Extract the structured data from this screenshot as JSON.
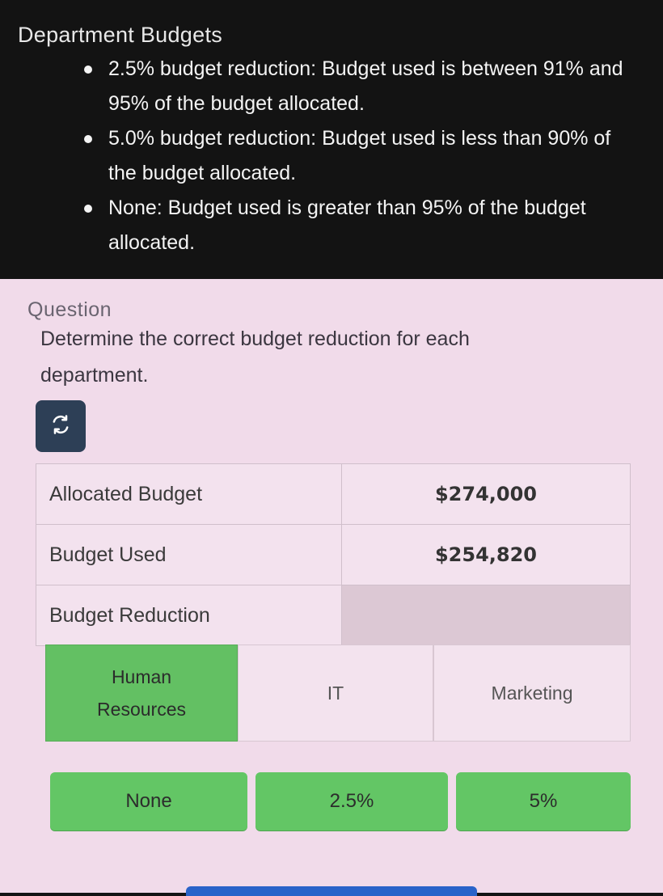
{
  "section": {
    "title": "Department Budgets",
    "rules": [
      "2.5% budget reduction: Budget used is between 91% and 95% of the budget allocated.",
      "5.0% budget reduction: Budget used is less than 90% of the budget allocated.",
      "None: Budget used is greater than 95% of the budget allocated."
    ]
  },
  "question": {
    "label": "Question",
    "text": "Determine the correct budget reduction for each department."
  },
  "reset": {
    "icon": "refresh-icon"
  },
  "table": {
    "rows": [
      {
        "label": "Allocated Budget",
        "value": "$274,000"
      },
      {
        "label": "Budget Used",
        "value": "$254,820"
      },
      {
        "label": "Budget Reduction",
        "value": ""
      }
    ]
  },
  "departments": [
    "Human Resources",
    "IT",
    "Marketing"
  ],
  "answers": [
    "None",
    "2.5%",
    "5%"
  ],
  "colors": {
    "accent_green": "#63c665",
    "button_dark": "#2d3f56",
    "panel_pink": "#f1dbea"
  }
}
